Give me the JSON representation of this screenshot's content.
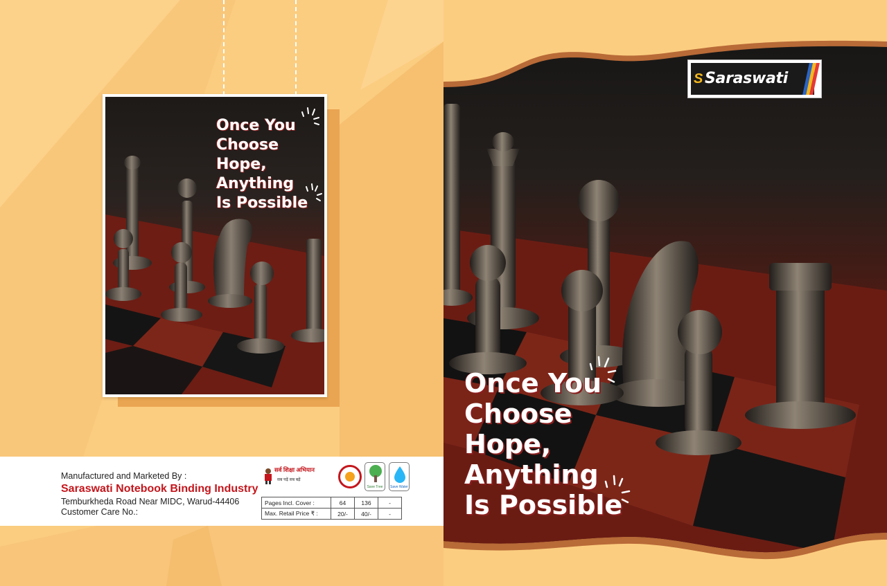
{
  "quote": {
    "lines": [
      "Once You",
      "Choose",
      "Hope,",
      "Anything",
      "Is Possible"
    ]
  },
  "brand": {
    "name": "Saraswati",
    "accent": "#c4161c",
    "background": "#fbcd80"
  },
  "back_cover": {
    "manufactured_label": "Manufactured and Marketed By :",
    "company": "Saraswati Notebook Binding Industry",
    "address": "Temburkheda Road Near MIDC, Warud-44406",
    "customer_care": "Customer Care No.:",
    "badges": {
      "abhiyan": "सर्व शिक्षा अभियान",
      "abhiyan_sub": "सब पढ़ें सब बढ़ें",
      "save_tree": "Save Tree",
      "save_water": "Save Water"
    },
    "price_table": [
      {
        "label": "Pages Incl. Cover :",
        "v1": "64",
        "v2": "136",
        "v3": "-"
      },
      {
        "label": "Max. Retail Price ₹ :",
        "v1": "20/-",
        "v2": "40/-",
        "v3": "-"
      }
    ]
  },
  "icons": [
    "chess-photo",
    "sparkle-icon",
    "swan-icon",
    "tree-icon",
    "water-drop-icon",
    "student-icon"
  ]
}
